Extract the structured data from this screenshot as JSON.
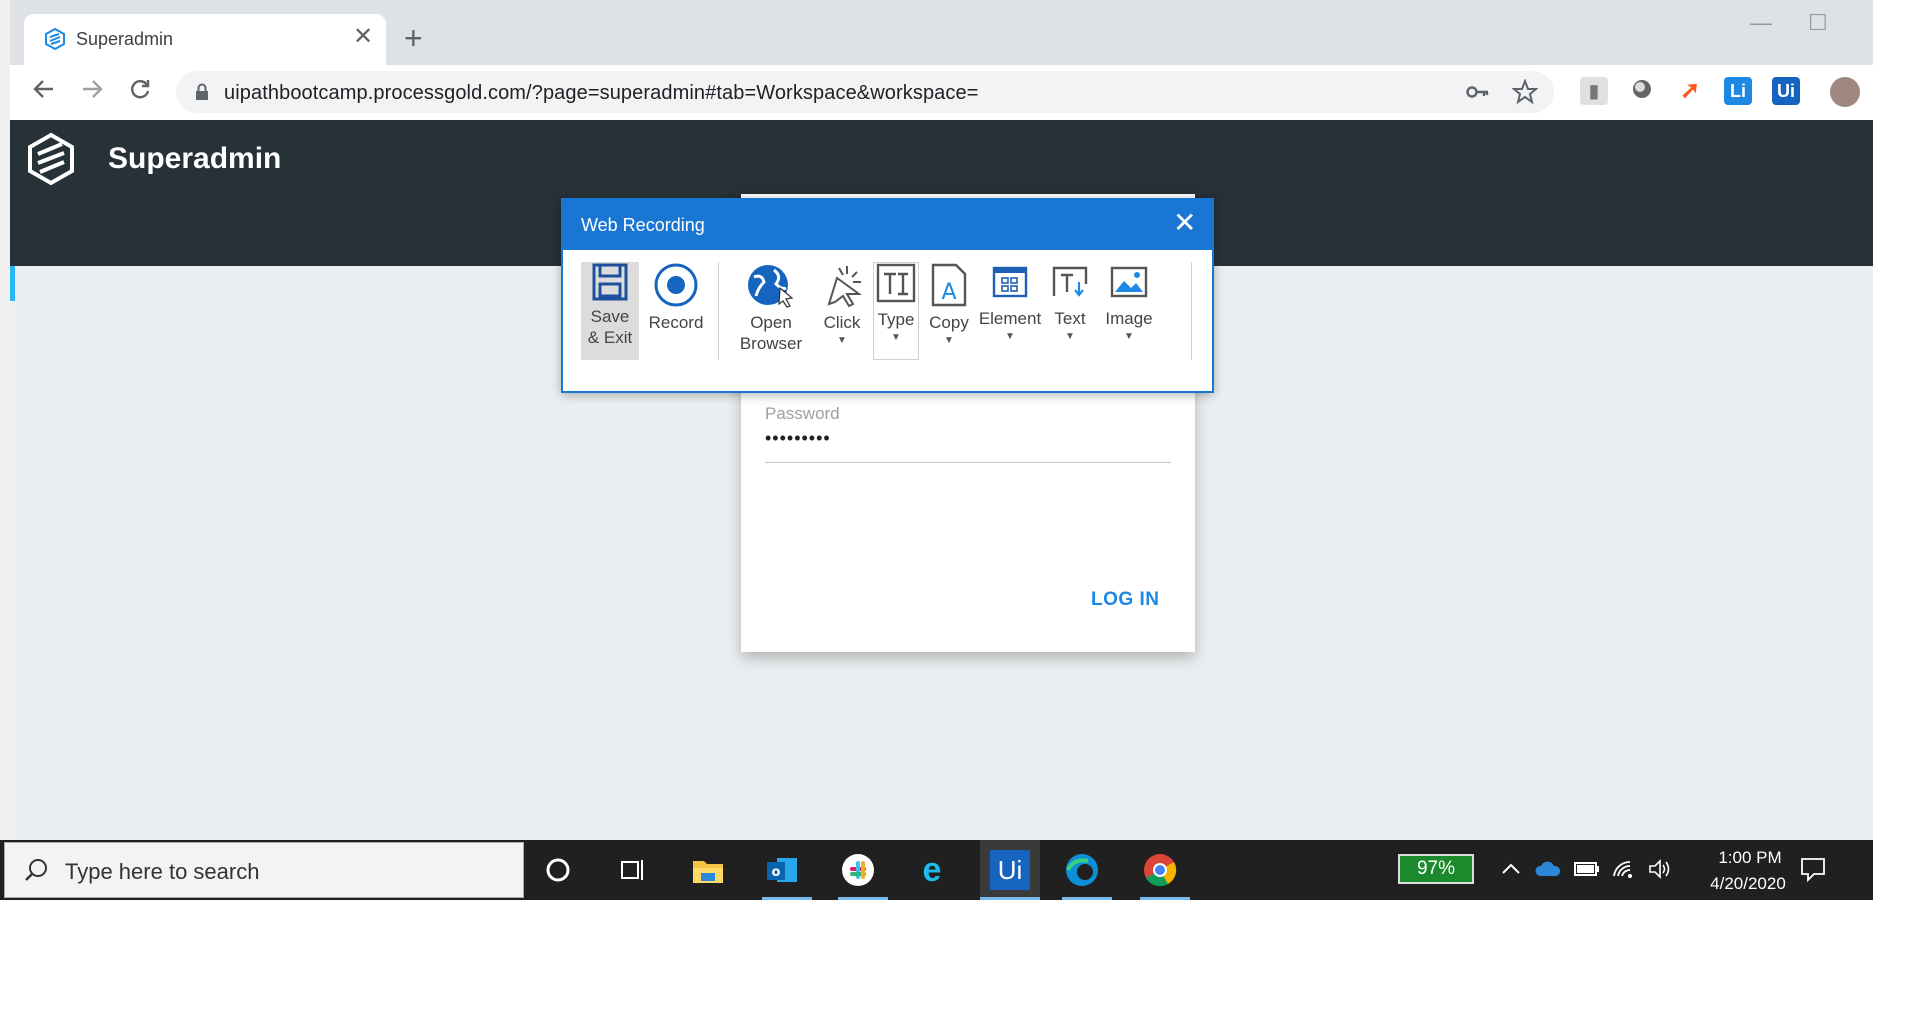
{
  "browser": {
    "tab_title": "Superadmin",
    "tab_close": "✕",
    "new_tab": "+",
    "url": "uipathbootcamp.processgold.com/?page=superadmin#tab=Workspace&workspace=",
    "extensions": [
      {
        "name": "key-icon"
      },
      {
        "name": "star-icon"
      },
      {
        "name": "extension-flag-icon"
      },
      {
        "name": "extension-circle-icon"
      },
      {
        "name": "extension-rocket-icon"
      },
      {
        "name": "extension-li-icon",
        "label": "Li"
      },
      {
        "name": "extension-ui-icon",
        "label": "Ui"
      },
      {
        "name": "profile-avatar-icon"
      }
    ]
  },
  "app": {
    "title": "Superadmin"
  },
  "login": {
    "password_label": "Password",
    "password_value": "•••••••••",
    "login_button": "LOG IN"
  },
  "dialog": {
    "title": "Web Recording",
    "close": "✕",
    "buttons": {
      "save": "Save\n& Exit",
      "record": "Record",
      "open_browser": "Open\nBrowser",
      "click": "Click",
      "type": "Type",
      "copy": "Copy",
      "element": "Element",
      "text": "Text",
      "image": "Image"
    }
  },
  "taskbar": {
    "search_placeholder": "Type here to search",
    "battery": "97%",
    "time": "1:00 PM",
    "date": "4/20/2020",
    "apps": [
      "cortana-icon",
      "task-view-icon",
      "file-explorer-icon",
      "outlook-icon",
      "slack-icon",
      "internet-explorer-icon",
      "uipath-studio-icon",
      "edge-icon",
      "chrome-icon"
    ],
    "uipath_label": "Ui"
  },
  "colors": {
    "accent": "#1976d2",
    "appbar": "#263238",
    "login_link": "#1e88e5",
    "battery": "#1a8a2c"
  }
}
